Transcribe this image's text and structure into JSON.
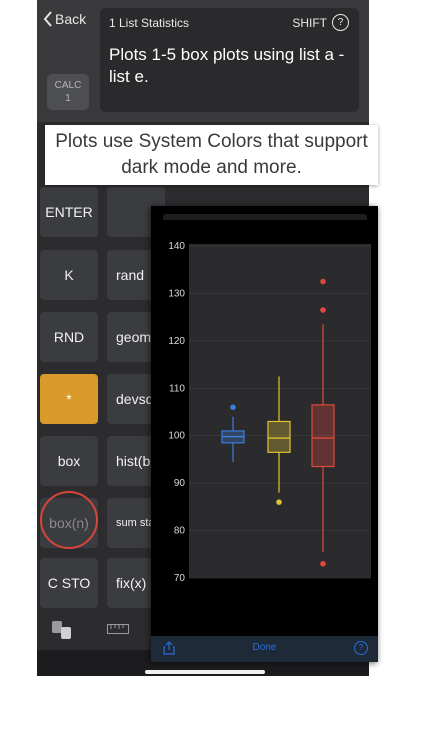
{
  "header": {
    "back_label": "Back",
    "calc_label": "CALC",
    "calc_sub": "1",
    "display_title": "1 List Statistics",
    "shift_label": "SHIFT",
    "help_glyph": "?",
    "display_text": "Plots 1-5 box plots using list a - list e."
  },
  "caption": "Plots use System Colors that support dark mode and more.",
  "keys": {
    "enter": "ENTER",
    "k": "K",
    "rand": "rand",
    "rnd": "RND",
    "geom": "geom",
    "star": "*",
    "devs": "devsq",
    "box": "box",
    "hist": "hist(b",
    "boxn": "box(n)",
    "sumstat": "sum sta",
    "csto": "C STO",
    "fix": "fix(x)"
  },
  "plot_footer": {
    "done_label": "Done",
    "info_glyph": "?"
  },
  "chart_data": {
    "type": "box",
    "ylim": [
      70,
      140
    ],
    "yticks": [
      70,
      80,
      90,
      100,
      110,
      120,
      130,
      140
    ],
    "grid": true,
    "series": [
      {
        "color": "#3b7ddd",
        "whisker_low": 94.5,
        "q1": 98.5,
        "median": 99.8,
        "q3": 101,
        "whisker_high": 104,
        "outliers": [
          106
        ]
      },
      {
        "color": "#e0c234",
        "whisker_low": 88,
        "q1": 96.5,
        "median": 99.5,
        "q3": 103,
        "whisker_high": 112.5,
        "outliers": [
          86
        ]
      },
      {
        "color": "#dd4a3c",
        "whisker_low": 75.5,
        "q1": 93.5,
        "median": 99.5,
        "q3": 106.5,
        "whisker_high": 123.5,
        "outliers": [
          73,
          126.5,
          132.5
        ]
      }
    ]
  }
}
